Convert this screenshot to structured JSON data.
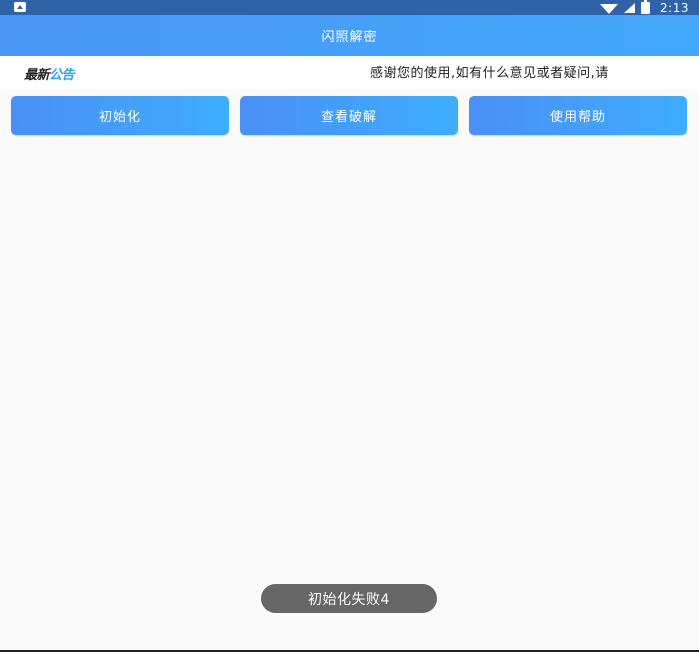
{
  "status_bar": {
    "time": "2:13",
    "icons": [
      "notification-icon",
      "wifi-icon",
      "signal-icon",
      "battery-icon"
    ]
  },
  "app_bar": {
    "title": "闪照解密"
  },
  "notice": {
    "logo_part1": "最新",
    "logo_part2": "公告",
    "text": "感谢您的使用,如有什么意见或者疑问,请"
  },
  "buttons": {
    "init_label": "初始化",
    "view_label": "查看破解",
    "help_label": "使用帮助"
  },
  "toast": {
    "message": "初始化失败4"
  },
  "colors": {
    "status_bar": "#2f62a6",
    "app_bar_start": "#4a97f5",
    "app_bar_end": "#42a7fb",
    "button": "#4a90f6",
    "logo_accent": "#2ba6e8",
    "toast": "#666666"
  }
}
